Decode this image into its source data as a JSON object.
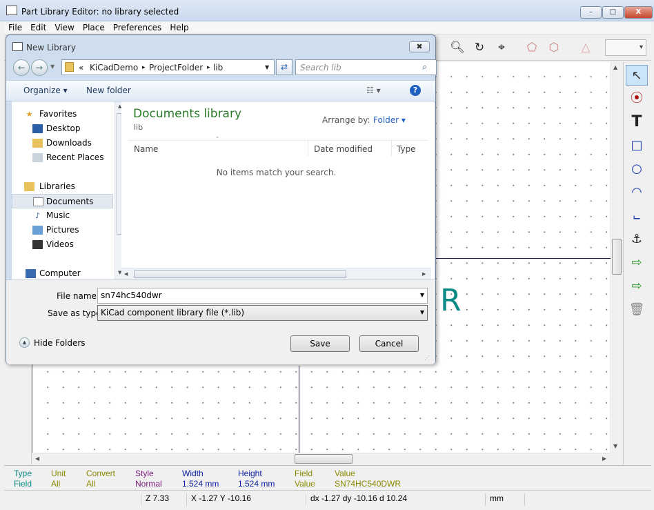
{
  "window": {
    "title": "Part Library Editor: no library selected",
    "min": "–",
    "max": "□",
    "close": "X"
  },
  "menu": [
    "File",
    "Edit",
    "View",
    "Place",
    "Preferences",
    "Help"
  ],
  "canvas_text": "R",
  "status_panel": {
    "headers": [
      "Type",
      "Unit",
      "Convert",
      "Style",
      "Width",
      "Height",
      "Field",
      "Value"
    ],
    "values": [
      "Field",
      "All",
      "All",
      "Normal",
      "1.524 mm",
      "1.524 mm",
      "Value",
      "SN74HC540DWR"
    ]
  },
  "statusbar": {
    "zoom": "Z 7.33",
    "pos": "X -1.27  Y -10.16",
    "delta": "dx -1.27  dy -10.16  d 10.24",
    "units": "mm"
  },
  "dialog": {
    "title": "New Library",
    "close": "✖",
    "breadcrumb": [
      "«",
      "KiCadDemo",
      "▸",
      "ProjectFolder",
      "▸",
      "lib"
    ],
    "search_placeholder": "Search lib",
    "organize": "Organize ▾",
    "new_folder": "New folder",
    "help": "?",
    "nav": {
      "favorites": "Favorites",
      "desktop": "Desktop",
      "downloads": "Downloads",
      "recent": "Recent Places",
      "libraries": "Libraries",
      "documents": "Documents",
      "music": "Music",
      "pictures": "Pictures",
      "videos": "Videos",
      "computer": "Computer"
    },
    "library_title": "Documents library",
    "library_sub": "lib",
    "arrange_label": "Arrange by:",
    "arrange_value": "Folder ▾",
    "columns": [
      "Name",
      "Date modified",
      "Type"
    ],
    "empty_msg": "No items match your search.",
    "file_name_label": "File name:",
    "file_name_value": "sn74hc540dwr",
    "save_type_label": "Save as type:",
    "save_type_value": "KiCad component library file (*.lib)",
    "hide_folders": "Hide Folders",
    "save": "Save",
    "cancel": "Cancel"
  },
  "colors": {
    "accent_green": "#2a7b2a",
    "field_blue": "#0a1ea0",
    "teal": "#0a8a85",
    "olive": "#8a8a00",
    "purple": "#7a1a7a"
  }
}
